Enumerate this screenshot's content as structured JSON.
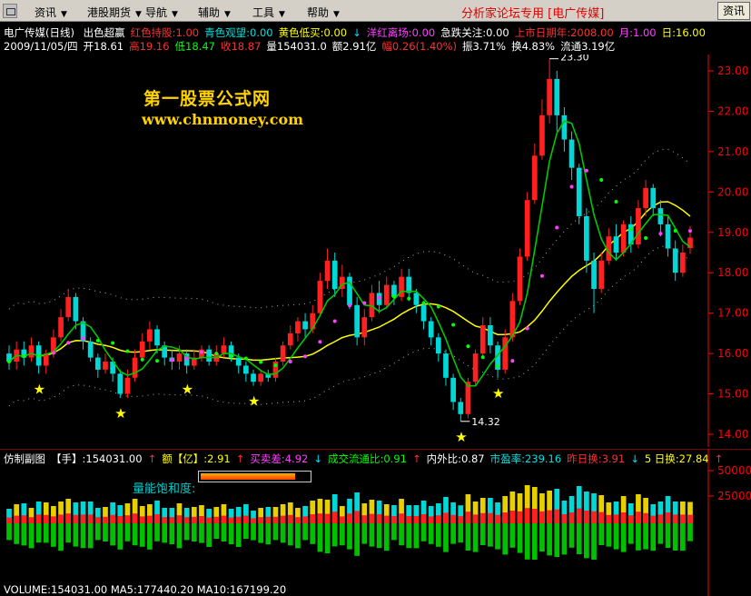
{
  "menu": {
    "items": [
      {
        "label": "资讯"
      },
      {
        "label": "港股期货"
      },
      {
        "label": "导航"
      },
      {
        "label": "辅助"
      },
      {
        "label": "工具"
      },
      {
        "label": "帮助"
      }
    ],
    "brand": "分析家论坛专用 [电广传媒]",
    "news_button": "资讯"
  },
  "indicator_line": {
    "title": "电广传媒(日线)",
    "items": [
      {
        "text": "出色超赢",
        "color": "#ffffff"
      },
      {
        "text": "红色持股:1.00",
        "color": "#ff3030"
      },
      {
        "text": "青色观望:0.00",
        "color": "#00e0e0"
      },
      {
        "text": "黄色低买:0.00",
        "color": "#ffff00"
      },
      {
        "text": "↓",
        "color": "#00e0ff"
      },
      {
        "text": "洋红离场:0.00",
        "color": "#ff40ff"
      },
      {
        "text": "急跌关注:0.00",
        "color": "#ffffff"
      },
      {
        "text": "上市日期年:2008.00",
        "color": "#ff3030"
      },
      {
        "text": "月:1.00",
        "color": "#ff40ff"
      },
      {
        "text": "日:16.00",
        "color": "#ffff00"
      }
    ]
  },
  "quote_line": {
    "items": [
      {
        "text": "2009/11/05/四",
        "color": "#ffffff"
      },
      {
        "text": "开18.61",
        "color": "#ffffff"
      },
      {
        "text": "高19.16",
        "color": "#ff3030"
      },
      {
        "text": "低18.47",
        "color": "#00ff00"
      },
      {
        "text": "收18.87",
        "color": "#ff3030"
      },
      {
        "text": "量154031.0",
        "color": "#ffffff"
      },
      {
        "text": "额2.91亿",
        "color": "#ffffff"
      },
      {
        "text": "幅0.26(1.40%)",
        "color": "#ff3030"
      },
      {
        "text": "振3.71%",
        "color": "#ffffff"
      },
      {
        "text": "换4.83%",
        "color": "#ffffff"
      },
      {
        "text": "流通3.19亿",
        "color": "#ffffff"
      }
    ]
  },
  "watermark": {
    "title": "第一股票公式网",
    "url": "www.chnmoney.com"
  },
  "sub_line": {
    "items": [
      {
        "text": "仿制副图",
        "color": "#ffffff"
      },
      {
        "text": "【手】:154031.00",
        "color": "#ffffff"
      },
      {
        "text": "↑",
        "color": "#ff3030"
      },
      {
        "text": "额【亿】:2.91",
        "color": "#ffff00"
      },
      {
        "text": "↑",
        "color": "#ff3030"
      },
      {
        "text": "买卖差:4.92",
        "color": "#ff40ff"
      },
      {
        "text": "↓",
        "color": "#00e0ff"
      },
      {
        "text": "成交流通比:0.91",
        "color": "#00ff00"
      },
      {
        "text": "↑",
        "color": "#ff3030"
      },
      {
        "text": "内外比:0.87",
        "color": "#ffffff"
      },
      {
        "text": "市盈率:239.16",
        "color": "#00e0e0"
      },
      {
        "text": "昨日换:3.91",
        "color": "#ff3030"
      },
      {
        "text": "↓",
        "color": "#00e0ff"
      },
      {
        "text": "5 日换:27.84",
        "color": "#ffff00"
      },
      {
        "text": "↑",
        "color": "#ff3030"
      }
    ]
  },
  "saturation": {
    "label": "量能饱和度:",
    "level": 0.86
  },
  "bottom_line": {
    "text": "VOLUME:154031.00  MA5:177440.20  MA10:167199.20"
  },
  "colors": {
    "up": "#ff2020",
    "down": "#00d8d8",
    "ma_fast": "#00c800",
    "ma_slow": "#ffff00",
    "trend": "#ff40ff",
    "trend_alt": "#00ff00",
    "axis": "#ff0000"
  },
  "chart_data": {
    "type": "candlestick",
    "y_axis_ticks": [
      23.0,
      22.0,
      21.0,
      20.0,
      19.0,
      18.0,
      17.0,
      16.0,
      15.0,
      14.0
    ],
    "ylim": [
      13.8,
      23.6
    ],
    "annotations": [
      {
        "text": "23.30",
        "value": 23.3
      },
      {
        "text": "14.32",
        "value": 14.32
      }
    ],
    "star_markers": 6,
    "candles": [
      {
        "o": 16.0,
        "c": 15.8,
        "h": 16.2,
        "l": 15.6
      },
      {
        "o": 15.8,
        "c": 16.1,
        "h": 16.3,
        "l": 15.6
      },
      {
        "o": 16.1,
        "c": 15.9,
        "h": 16.3,
        "l": 15.7
      },
      {
        "o": 15.9,
        "c": 16.2,
        "h": 16.4,
        "l": 15.8
      },
      {
        "o": 16.2,
        "c": 15.7,
        "h": 16.3,
        "l": 15.5
      },
      {
        "o": 15.7,
        "c": 16.0,
        "h": 16.1,
        "l": 15.5
      },
      {
        "o": 16.0,
        "c": 16.4,
        "h": 16.6,
        "l": 15.9
      },
      {
        "o": 16.4,
        "c": 16.9,
        "h": 17.1,
        "l": 16.3
      },
      {
        "o": 16.9,
        "c": 17.4,
        "h": 17.6,
        "l": 16.8
      },
      {
        "o": 17.4,
        "c": 16.8,
        "h": 17.5,
        "l": 16.6
      },
      {
        "o": 16.8,
        "c": 16.3,
        "h": 16.9,
        "l": 16.1
      },
      {
        "o": 16.3,
        "c": 15.9,
        "h": 16.4,
        "l": 15.8
      },
      {
        "o": 15.9,
        "c": 15.6,
        "h": 16.0,
        "l": 15.4
      },
      {
        "o": 15.6,
        "c": 15.8,
        "h": 16.0,
        "l": 15.5
      },
      {
        "o": 15.8,
        "c": 15.5,
        "h": 15.9,
        "l": 15.3
      },
      {
        "o": 15.5,
        "c": 15.0,
        "h": 15.6,
        "l": 14.9
      },
      {
        "o": 15.0,
        "c": 15.4,
        "h": 15.6,
        "l": 14.9
      },
      {
        "o": 15.4,
        "c": 15.9,
        "h": 16.1,
        "l": 15.3
      },
      {
        "o": 15.9,
        "c": 16.3,
        "h": 16.5,
        "l": 15.8
      },
      {
        "o": 16.3,
        "c": 16.6,
        "h": 16.8,
        "l": 16.1
      },
      {
        "o": 16.6,
        "c": 16.2,
        "h": 16.7,
        "l": 16.0
      },
      {
        "o": 16.2,
        "c": 15.9,
        "h": 16.3,
        "l": 15.7
      },
      {
        "o": 15.9,
        "c": 15.8,
        "h": 16.1,
        "l": 15.6
      },
      {
        "o": 15.8,
        "c": 16.0,
        "h": 16.2,
        "l": 15.6
      },
      {
        "o": 16.0,
        "c": 15.7,
        "h": 16.1,
        "l": 15.5
      },
      {
        "o": 15.7,
        "c": 15.9,
        "h": 16.1,
        "l": 15.6
      },
      {
        "o": 15.9,
        "c": 16.1,
        "h": 16.2,
        "l": 15.8
      },
      {
        "o": 16.1,
        "c": 15.8,
        "h": 16.2,
        "l": 15.7
      },
      {
        "o": 15.8,
        "c": 16.0,
        "h": 16.2,
        "l": 15.7
      },
      {
        "o": 16.0,
        "c": 16.2,
        "h": 16.4,
        "l": 15.9
      },
      {
        "o": 16.2,
        "c": 15.9,
        "h": 16.3,
        "l": 15.8
      },
      {
        "o": 15.9,
        "c": 15.7,
        "h": 16.0,
        "l": 15.5
      },
      {
        "o": 15.7,
        "c": 15.5,
        "h": 15.8,
        "l": 15.3
      },
      {
        "o": 15.5,
        "c": 15.3,
        "h": 15.6,
        "l": 15.2
      },
      {
        "o": 15.3,
        "c": 15.5,
        "h": 15.6,
        "l": 15.2
      },
      {
        "o": 15.5,
        "c": 15.4,
        "h": 15.6,
        "l": 15.3
      },
      {
        "o": 15.4,
        "c": 15.8,
        "h": 15.9,
        "l": 15.3
      },
      {
        "o": 15.8,
        "c": 16.2,
        "h": 16.3,
        "l": 15.7
      },
      {
        "o": 16.2,
        "c": 16.5,
        "h": 16.7,
        "l": 16.1
      },
      {
        "o": 16.5,
        "c": 16.8,
        "h": 16.9,
        "l": 16.3
      },
      {
        "o": 16.8,
        "c": 16.6,
        "h": 17.0,
        "l": 16.4
      },
      {
        "o": 16.6,
        "c": 17.0,
        "h": 17.2,
        "l": 16.5
      },
      {
        "o": 17.0,
        "c": 17.8,
        "h": 18.0,
        "l": 16.9
      },
      {
        "o": 17.8,
        "c": 18.3,
        "h": 18.6,
        "l": 17.6
      },
      {
        "o": 18.3,
        "c": 17.6,
        "h": 18.5,
        "l": 17.4
      },
      {
        "o": 17.6,
        "c": 17.9,
        "h": 18.2,
        "l": 17.4
      },
      {
        "o": 17.9,
        "c": 17.2,
        "h": 18.0,
        "l": 17.1
      },
      {
        "o": 17.2,
        "c": 16.4,
        "h": 17.4,
        "l": 16.2
      },
      {
        "o": 16.4,
        "c": 16.9,
        "h": 17.1,
        "l": 16.2
      },
      {
        "o": 16.9,
        "c": 17.5,
        "h": 17.7,
        "l": 16.8
      },
      {
        "o": 17.5,
        "c": 17.2,
        "h": 17.8,
        "l": 17.0
      },
      {
        "o": 17.2,
        "c": 17.7,
        "h": 17.9,
        "l": 17.1
      },
      {
        "o": 17.7,
        "c": 17.4,
        "h": 17.8,
        "l": 17.2
      },
      {
        "o": 17.4,
        "c": 17.9,
        "h": 18.1,
        "l": 17.3
      },
      {
        "o": 17.9,
        "c": 17.5,
        "h": 18.1,
        "l": 17.3
      },
      {
        "o": 17.5,
        "c": 17.2,
        "h": 17.6,
        "l": 17.0
      },
      {
        "o": 17.2,
        "c": 16.8,
        "h": 17.3,
        "l": 16.6
      },
      {
        "o": 16.8,
        "c": 16.4,
        "h": 16.9,
        "l": 16.2
      },
      {
        "o": 16.4,
        "c": 16.0,
        "h": 16.5,
        "l": 15.8
      },
      {
        "o": 16.0,
        "c": 15.4,
        "h": 16.1,
        "l": 15.2
      },
      {
        "o": 15.4,
        "c": 14.8,
        "h": 15.5,
        "l": 14.6
      },
      {
        "o": 14.8,
        "c": 14.5,
        "h": 14.9,
        "l": 14.32
      },
      {
        "o": 14.5,
        "c": 15.3,
        "h": 15.4,
        "l": 14.4
      },
      {
        "o": 15.3,
        "c": 16.0,
        "h": 16.1,
        "l": 15.2
      },
      {
        "o": 16.0,
        "c": 16.7,
        "h": 16.9,
        "l": 15.9
      },
      {
        "o": 16.7,
        "c": 16.2,
        "h": 16.9,
        "l": 16.0
      },
      {
        "o": 16.2,
        "c": 15.6,
        "h": 16.3,
        "l": 15.4
      },
      {
        "o": 15.6,
        "c": 16.4,
        "h": 16.6,
        "l": 15.5
      },
      {
        "o": 16.4,
        "c": 17.3,
        "h": 17.5,
        "l": 16.3
      },
      {
        "o": 17.3,
        "c": 18.4,
        "h": 18.6,
        "l": 17.2
      },
      {
        "o": 18.4,
        "c": 19.8,
        "h": 20.0,
        "l": 18.3
      },
      {
        "o": 19.8,
        "c": 20.9,
        "h": 21.2,
        "l": 19.7
      },
      {
        "o": 20.9,
        "c": 21.9,
        "h": 22.3,
        "l": 20.8
      },
      {
        "o": 21.9,
        "c": 22.8,
        "h": 23.3,
        "l": 21.7
      },
      {
        "o": 22.8,
        "c": 21.9,
        "h": 23.0,
        "l": 21.5
      },
      {
        "o": 21.9,
        "c": 21.3,
        "h": 22.1,
        "l": 21.0
      },
      {
        "o": 21.3,
        "c": 20.6,
        "h": 21.5,
        "l": 20.3
      },
      {
        "o": 20.6,
        "c": 19.4,
        "h": 20.7,
        "l": 19.2
      },
      {
        "o": 19.4,
        "c": 18.3,
        "h": 19.6,
        "l": 18.0
      },
      {
        "o": 18.3,
        "c": 17.6,
        "h": 18.5,
        "l": 17.0
      },
      {
        "o": 17.6,
        "c": 18.3,
        "h": 18.5,
        "l": 17.5
      },
      {
        "o": 18.3,
        "c": 18.9,
        "h": 19.1,
        "l": 18.2
      },
      {
        "o": 18.9,
        "c": 18.5,
        "h": 19.2,
        "l": 18.3
      },
      {
        "o": 18.5,
        "c": 19.2,
        "h": 19.3,
        "l": 18.4
      },
      {
        "o": 19.2,
        "c": 18.7,
        "h": 19.4,
        "l": 18.5
      },
      {
        "o": 18.7,
        "c": 19.6,
        "h": 19.8,
        "l": 18.6
      },
      {
        "o": 19.6,
        "c": 20.1,
        "h": 20.3,
        "l": 19.4
      },
      {
        "o": 20.1,
        "c": 19.6,
        "h": 20.2,
        "l": 19.4
      },
      {
        "o": 19.6,
        "c": 19.2,
        "h": 19.8,
        "l": 18.9
      },
      {
        "o": 19.2,
        "c": 18.6,
        "h": 19.4,
        "l": 18.4
      },
      {
        "o": 18.6,
        "c": 18.0,
        "h": 18.8,
        "l": 17.8
      },
      {
        "o": 18.0,
        "c": 18.5,
        "h": 18.7,
        "l": 17.9
      },
      {
        "o": 18.61,
        "c": 18.87,
        "h": 19.16,
        "l": 18.47
      }
    ]
  }
}
